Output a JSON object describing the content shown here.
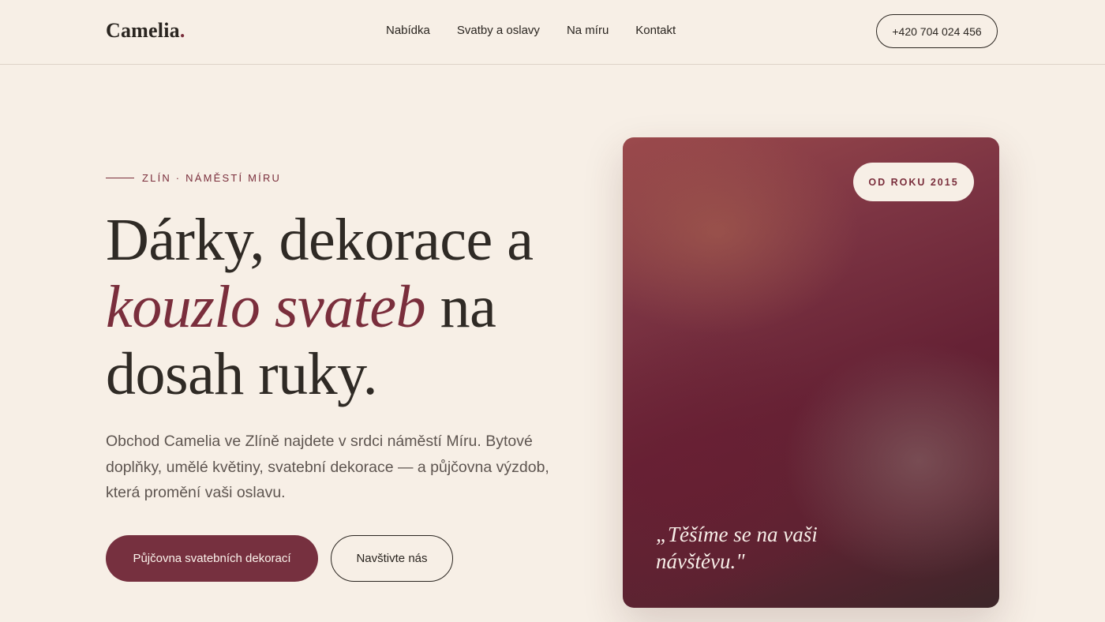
{
  "header": {
    "logo_text": "Camelia",
    "logo_dot": ".",
    "nav": [
      "Nabídka",
      "Svatby a oslavy",
      "Na míru",
      "Kontakt"
    ],
    "phone": "+420 704 024 456"
  },
  "hero": {
    "eyebrow": "ZLÍN · NÁMĚSTÍ MÍRU",
    "headline_part1": "Dárky, dekorace a ",
    "headline_emphasis": "kouzlo svateb",
    "headline_part2": " na dosah ruky.",
    "lead": "Obchod Camelia ve Zlíně najdete v srdci náměstí Míru. Bytové doplňky, umělé květiny, svatební dekorace — a půjčovna výzdob, která promění vaši oslavu.",
    "primary_button": "Půjčovna svatebních dekorací",
    "secondary_button": "Navštivte nás"
  },
  "card": {
    "badge": "OD ROKU 2015",
    "quote": "„Těšíme se na vaši návštěvu.\""
  },
  "colors": {
    "accent": "#76303f",
    "background": "#f7efe6",
    "text": "#2f2a25"
  }
}
